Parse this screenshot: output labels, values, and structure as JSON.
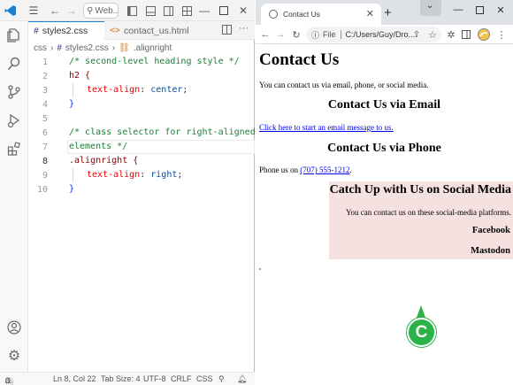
{
  "vscode": {
    "search_text": "Web...",
    "tabs": [
      {
        "label": "styles2.css",
        "icon": "hash-icon"
      },
      {
        "label": "contact_us.html",
        "icon": "html-chevron-icon"
      }
    ],
    "breadcrumb": {
      "folder": "css",
      "file": "styles2.css",
      "symbol": ".alignright"
    },
    "lines": [
      {
        "n": "1",
        "text": "/* second-level heading style */"
      },
      {
        "n": "2",
        "text": "h2 {"
      },
      {
        "n": "3",
        "prop": "text-align",
        "val": "center"
      },
      {
        "n": "4",
        "text": "}"
      },
      {
        "n": "5",
        "text": ""
      },
      {
        "n": "6",
        "text": "/* class selector for right-aligned"
      },
      {
        "n": "7",
        "text": "elements */"
      },
      {
        "n": "8",
        "text": ".alignright {"
      },
      {
        "n": "9",
        "prop": "text-align",
        "val": "right"
      },
      {
        "n": "10",
        "text": "}"
      }
    ],
    "status": {
      "errors": "0",
      "warnings": "0",
      "position": "Ln 8, Col 22",
      "tab_size": "Tab Size: 4",
      "encoding": "UTF-8",
      "eol": "CRLF",
      "language": "CSS"
    }
  },
  "chrome": {
    "tab_title": "Contact Us",
    "omnibox": {
      "scheme": "File",
      "path": "C:/Users/Guy/Dro..."
    },
    "page": {
      "h1": "Contact Us",
      "intro": "You can contact us via email, phone, or social media.",
      "email_heading": "Contact Us via Email",
      "email_link": "Click here to start an email message to us.",
      "phone_heading": "Contact Us via Phone",
      "phone_prefix": "Phone us on ",
      "phone_link": "(707) 555-1212",
      "phone_suffix": ".",
      "social_heading": "Catch Up with Us on Social Media",
      "social_text": "You can contact us on these social-media platforms.",
      "social_items": [
        "Facebook",
        "Mastodon"
      ]
    }
  },
  "callout": {
    "label": "C",
    "color": "#2bb34a"
  }
}
